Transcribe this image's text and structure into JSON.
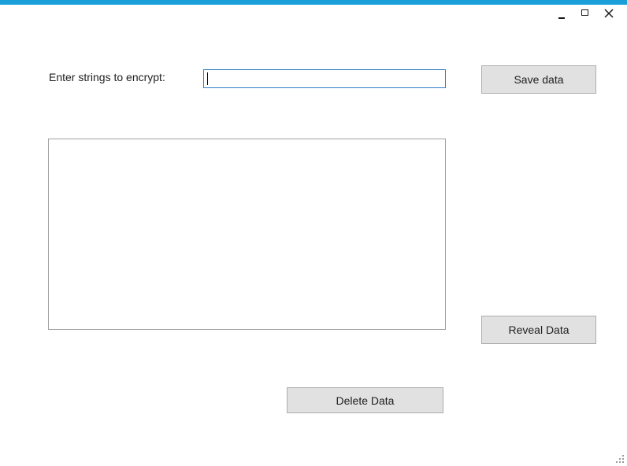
{
  "window": {
    "accent_color": "#1a9fd9",
    "controls": {
      "minimize_icon": "minimize-icon",
      "maximize_icon": "maximize-icon",
      "close_icon": "close-icon"
    }
  },
  "form": {
    "prompt_label": "Enter strings to encrypt:",
    "input_value": "",
    "save_label": "Save data",
    "reveal_label": "Reveal Data",
    "delete_label": "Delete Data",
    "output_text": ""
  }
}
